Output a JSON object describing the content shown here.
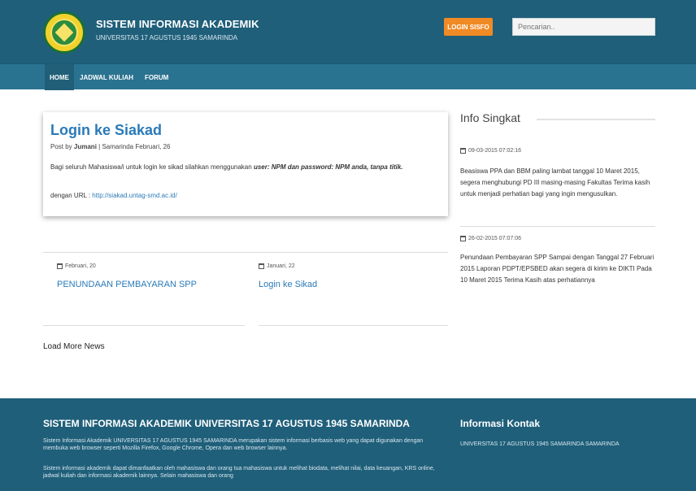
{
  "header": {
    "title": "SISTEM INFORMASI AKADEMIK",
    "subtitle": "UNIVERSITAS 17 AGUSTUS 1945 SAMARINDA",
    "login_label": "LOGIN SISFO",
    "search_placeholder": "Pencarian..",
    "logo_icon": "university-seal-icon"
  },
  "nav": {
    "items": [
      {
        "label": "HOME"
      },
      {
        "label": "JADWAL KULIAH"
      },
      {
        "label": "FORUM"
      }
    ]
  },
  "featured": {
    "title": "Login ke Siakad",
    "meta_prefix": "Post by ",
    "author": "Jumani",
    "meta_suffix": " | Samarinda Februari, 26",
    "body_text": "Bagi seluruh Mahasiswa/i untuk login ke sikad silahkan menggunakan ",
    "body_emphasis": "user: NPM dan password:  NPM anda, tanpa titik.",
    "url_label": "dengan URL : ",
    "url": "http://siakad.untag-smd.ac.id/"
  },
  "news": [
    {
      "date": "Februari, 20",
      "title": "PENUNDAAN PEMBAYARAN SPP"
    },
    {
      "date": "Januari, 22",
      "title": "Login ke Sikad"
    }
  ],
  "load_more": "Load More News",
  "sidebar": {
    "heading": "Info Singkat",
    "items": [
      {
        "date": "09-03-2015 07:02:16",
        "text": "Beasiswa PPA dan BBM paling lambat tanggal 10 Maret 2015, segera menghubungi PD III masing-masing Fakultas Terima kasih untuk menjadi perhatian bagi yang ingin mengusulkan."
      },
      {
        "date": "26-02-2015 07:07:06",
        "text": "Penundaan Pembayaran SPP Sampai dengan Tanggal 27 Februari 2015 Laporan PDPT/EPSBED akan segera di kirim ke DIKTI Pada 10 Maret 2015 Terima Kasih atas perhatiannya"
      }
    ]
  },
  "footer": {
    "title": "SISTEM INFORMASI AKADEMIK UNIVERSITAS 17 AGUSTUS 1945 SAMARINDA",
    "p1": "Sistem Informasi Akademik UNIVERSITAS 17 AGUSTUS 1945 SAMARINDA merupakan sistem informasi berbasis web yang dapat digunakan dengan membuka web browser seperti Mozilla Firefox, Google Chrome, Opera dan web browser lainnya.",
    "p2": "Sistem informasi akademik dapat dimanfaatkan oleh mahasiswa dan orang tua mahasiswa untuk melihat biodata, melihat nilai, data keuangan, KRS online, jadwal kuliah dan informasi akademik lainnya. Selain mahasiswa dan orang",
    "contact_title": "Informasi Kontak",
    "contact_text": "UNIVERSITAS 17 AGUSTUS 1945 SAMARINDA SAMARINDA"
  },
  "colors": {
    "header_bg": "#1f5f7a",
    "nav_bg": "#2a7390",
    "accent_orange": "#f08a24",
    "link_blue": "#2a7ab8"
  }
}
